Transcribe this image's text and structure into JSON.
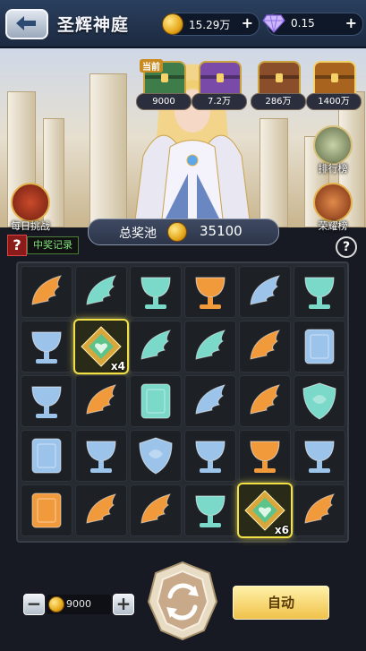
{
  "header": {
    "title": "圣辉神庭",
    "gold": "15.29万",
    "gems": "0.15"
  },
  "chests": [
    {
      "tag": "当前",
      "value": "9000",
      "color": "#3e7c4a"
    },
    {
      "tag": "",
      "value": "7.2万",
      "color": "#7a4aa8"
    },
    {
      "tag": "",
      "value": "286万",
      "color": "#8a4e2a"
    },
    {
      "tag": "",
      "value": "1400万",
      "color": "#a8631e"
    }
  ],
  "side_buttons": {
    "daily": "每日挑战",
    "rank": "排行榜",
    "glory": "荣耀榜"
  },
  "prize_pool": {
    "label": "总奖池",
    "value": "35100"
  },
  "record_button": {
    "icon_text": "?",
    "label": "中奖记录"
  },
  "help_icon": "?",
  "grid": [
    [
      "wing-orange",
      "wing-teal",
      "cup-teal",
      "cup-orange",
      "wing-blue",
      "cup-teal"
    ],
    [
      "cup-blue",
      "emblem-green",
      "wing-teal",
      "wing-teal",
      "wing-orange",
      "book-blue"
    ],
    [
      "cup-blue",
      "wing-orange",
      "book-teal",
      "wing-blue",
      "wing-orange",
      "shield-teal"
    ],
    [
      "book-blue",
      "cup-blue",
      "shield-blue",
      "cup-blue",
      "cup-orange",
      "cup-blue"
    ],
    [
      "book-orange",
      "wing-orange",
      "wing-orange",
      "cup-teal",
      "emblem-green",
      "wing-orange"
    ]
  ],
  "highlights": [
    {
      "row": 1,
      "col": 1,
      "multiplier": "x4"
    },
    {
      "row": 4,
      "col": 4,
      "multiplier": "x6"
    }
  ],
  "bet": {
    "value": "9000",
    "minus": "−",
    "plus": "+"
  },
  "auto_button": "自动",
  "colors": {
    "orange": "#f09a3c",
    "teal": "#7ad9c9",
    "blue": "#9cc4ea",
    "green": "#5cc38a",
    "highlight": "#f2e146"
  }
}
